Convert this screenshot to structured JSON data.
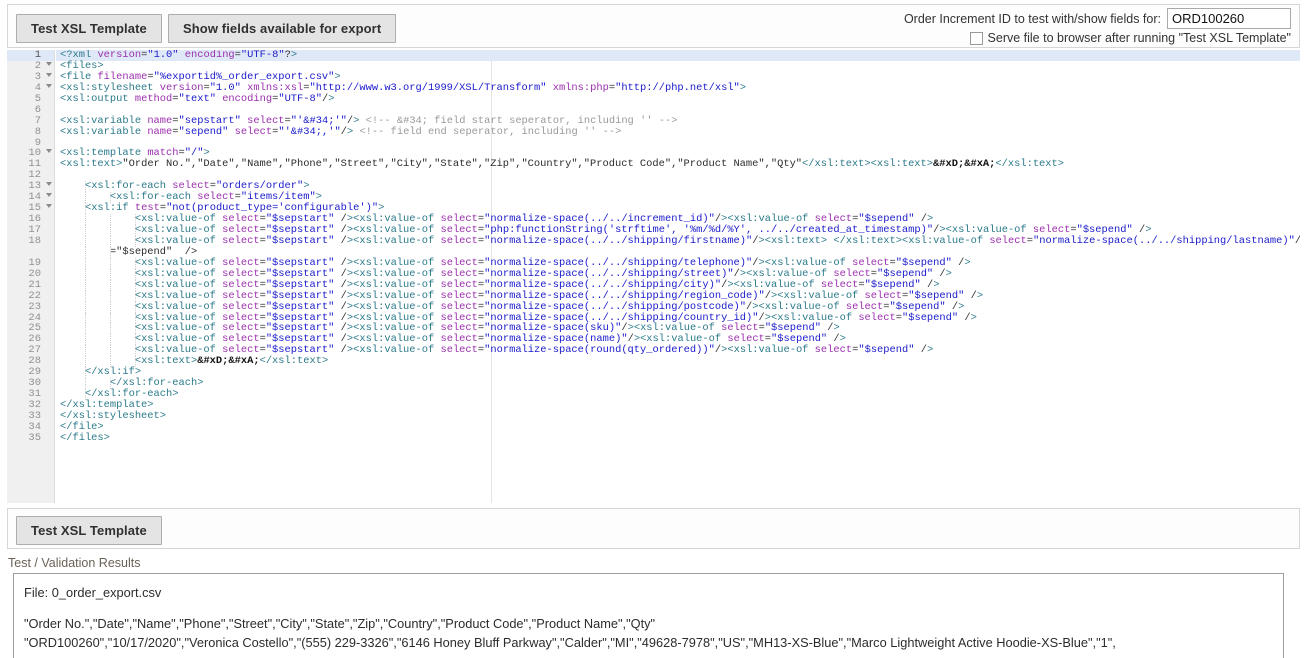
{
  "toolbar": {
    "test_button_label": "Test XSL Template",
    "show_fields_button_label": "Show fields available for export",
    "order_id_label": "Order Increment ID to test with/show fields for:",
    "order_id_value": "ORD100260",
    "serve_file_checkbox_label": "Serve file to browser after running \"Test XSL Template\"",
    "serve_file_checked": false
  },
  "editor": {
    "active_line": 1,
    "total_lines": 35,
    "fold_lines": [
      2,
      3,
      4,
      10,
      13,
      14,
      15
    ],
    "lines": [
      "<?xml version=\"1.0\" encoding=\"UTF-8\"?>",
      "<files>",
      "<file filename=\"%exportid%_order_export.csv\">",
      "<xsl:stylesheet version=\"1.0\" xmlns:xsl=\"http://www.w3.org/1999/XSL/Transform\" xmlns:php=\"http://php.net/xsl\">",
      "<xsl:output method=\"text\" encoding=\"UTF-8\"/>",
      "",
      "<xsl:variable name=\"sepstart\" select=\"'&#34;'\"/> <!-- &#34; field start seperator, including '' -->",
      "<xsl:variable name=\"sepend\" select=\"'&#34;,'\"/> <!-- field end seperator, including '' -->",
      "",
      "<xsl:template match=\"/\">",
      "<xsl:text>\"Order No.\",\"Date\",\"Name\",\"Phone\",\"Street\",\"City\",\"State\",\"Zip\",\"Country\",\"Product Code\",\"Product Name\",\"Qty\"</xsl:text><xsl:text>&#xD;&#xA;</xsl:text>",
      "",
      "    <xsl:for-each select=\"orders/order\">",
      "        <xsl:for-each select=\"items/item\">",
      "    <xsl:if test=\"not(product_type='configurable')\">",
      "            <xsl:value-of select=\"$sepstart\" /><xsl:value-of select=\"normalize-space(../../increment_id)\"/><xsl:value-of select=\"$sepend\" />",
      "            <xsl:value-of select=\"$sepstart\" /><xsl:value-of select=\"php:functionString('strftime', '%m/%d/%Y', ../../created_at_timestamp)\"/><xsl:value-of select=\"$sepend\" />",
      "            <xsl:value-of select=\"$sepstart\" /><xsl:value-of select=\"normalize-space(../../shipping/firstname)\"/><xsl:text> </xsl:text><xsl:value-of select=\"normalize-space(../../shipping/lastname)\"/><xsl:value-of select",
      "            <xsl:value-of select=\"$sepstart\" /><xsl:value-of select=\"normalize-space(../../shipping/telephone)\"/><xsl:value-of select=\"$sepend\" />",
      "            <xsl:value-of select=\"$sepstart\" /><xsl:value-of select=\"normalize-space(../../shipping/street)\"/><xsl:value-of select=\"$sepend\" />",
      "            <xsl:value-of select=\"$sepstart\" /><xsl:value-of select=\"normalize-space(../../shipping/city)\"/><xsl:value-of select=\"$sepend\" />",
      "            <xsl:value-of select=\"$sepstart\" /><xsl:value-of select=\"normalize-space(../../shipping/region_code)\"/><xsl:value-of select=\"$sepend\" />",
      "            <xsl:value-of select=\"$sepstart\" /><xsl:value-of select=\"normalize-space(../../shipping/postcode)\"/><xsl:value-of select=\"$sepend\" />",
      "            <xsl:value-of select=\"$sepstart\" /><xsl:value-of select=\"normalize-space(../../shipping/country_id)\"/><xsl:value-of select=\"$sepend\" />",
      "            <xsl:value-of select=\"$sepstart\" /><xsl:value-of select=\"normalize-space(sku)\"/><xsl:value-of select=\"$sepend\" />",
      "            <xsl:value-of select=\"$sepstart\" /><xsl:value-of select=\"normalize-space(name)\"/><xsl:value-of select=\"$sepend\" />",
      "            <xsl:value-of select=\"$sepstart\" /><xsl:value-of select=\"normalize-space(round(qty_ordered))\"/><xsl:value-of select=\"$sepend\" />",
      "            <xsl:text>&#xD;&#xA;</xsl:text>",
      "    </xsl:if>",
      "        </xsl:for-each>",
      "    </xsl:for-each>",
      "</xsl:template>",
      "</xsl:stylesheet>",
      "</file>",
      "</files>"
    ],
    "line18_continuation": "        =\"$sepend\"  />"
  },
  "bottom": {
    "test_button_label": "Test XSL Template",
    "results_label": "Test / Validation Results",
    "result_file_line": "File: 0_order_export.csv",
    "result_header_line": "\"Order No.\",\"Date\",\"Name\",\"Phone\",\"Street\",\"City\",\"State\",\"Zip\",\"Country\",\"Product Code\",\"Product Name\",\"Qty\"",
    "result_data_line": "\"ORD100260\",\"10/17/2020\",\"Veronica Costello\",\"(555) 229-3326\",\"6146 Honey Bluff Parkway\",\"Calder\",\"MI\",\"49628-7978\",\"US\",\"MH13-XS-Blue\",\"Marco Lightweight Active Hoodie-XS-Blue\",\"1\","
  },
  "colors": {
    "tag": "#2b7a8a",
    "attribute": "#9b2fae",
    "value": "#1a1acb",
    "comment": "#9a9a9a",
    "active_line": "#dfe8f6",
    "gutter_bg": "#f0f0f0"
  }
}
